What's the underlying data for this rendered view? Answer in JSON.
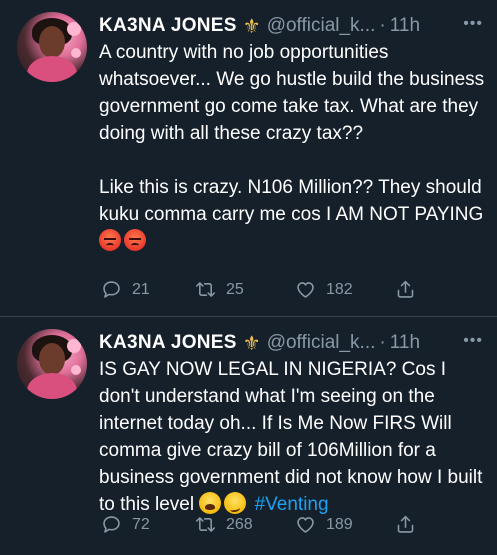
{
  "tweets": [
    {
      "author_name": "KA3NA JONES",
      "badge_icon": "fleur-de-lis-icon",
      "handle": "@official_k...",
      "separator": "·",
      "time": "11h",
      "paragraphs": [
        "A country with no job opportunities whatsoever... We go hustle build the business government go come take tax. What are they doing with all these crazy tax??",
        "Like this is crazy. N106 Million?? They should kuku comma carry me cos I AM NOT PAYING"
      ],
      "trailing_emojis": [
        "angry-face-emoji",
        "angry-face-emoji"
      ],
      "replies": "21",
      "retweets": "25",
      "likes": "182"
    },
    {
      "author_name": "KA3NA JONES",
      "badge_icon": "fleur-de-lis-icon",
      "handle": "@official_k...",
      "separator": "·",
      "time": "11h",
      "text": "IS GAY NOW LEGAL IN NIGERIA? Cos I don't understand what I'm seeing on the internet today oh... If Is Me Now FIRS Will comma give crazy bill of 106Million for a business government did not know how I built to this level",
      "trailing_emojis": [
        "weary-face-emoji",
        "woozy-face-emoji"
      ],
      "hashtag": "#Venting",
      "replies": "72",
      "retweets": "268",
      "likes": "189"
    }
  ],
  "colors": {
    "background": "#15202b",
    "text_primary": "#ffffff",
    "text_secondary": "#8899a6",
    "link": "#1da1f2",
    "divider": "#38444d",
    "badge": "#f2c14e"
  }
}
